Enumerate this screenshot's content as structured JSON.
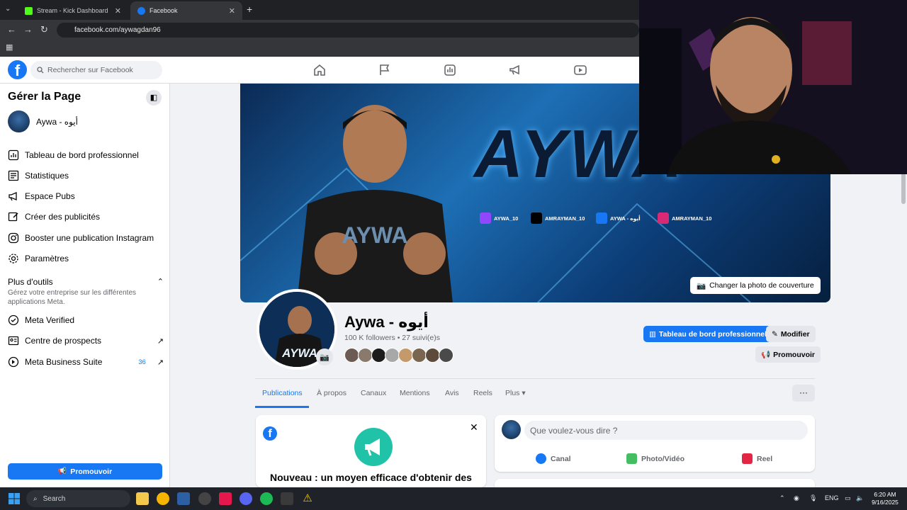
{
  "browser": {
    "tabs": [
      {
        "title": "Stream - Kick Dashboard",
        "active": false,
        "color": "#53fc18"
      },
      {
        "title": "Facebook",
        "active": true,
        "color": "#1877f2"
      }
    ],
    "new_tab": "+",
    "url": "facebook.com/aywagdan96"
  },
  "header": {
    "logo": "f",
    "search_placeholder": "Rechercher sur Facebook",
    "nav_icons": [
      "home-icon",
      "flag-icon",
      "dashboard-icon",
      "megaphone-icon",
      "video-icon"
    ]
  },
  "sidebar": {
    "title": "Gérer la Page",
    "page_name": "Aywa - أيوه",
    "items": [
      {
        "label": "Tableau de bord professionnel",
        "icon": "dashboard-icon"
      },
      {
        "label": "Statistiques",
        "icon": "stats-icon"
      },
      {
        "label": "Espace Pubs",
        "icon": "megaphone-icon"
      },
      {
        "label": "Créer des publicités",
        "icon": "edit-icon"
      },
      {
        "label": "Booster une publication Instagram",
        "icon": "instagram-icon"
      },
      {
        "label": "Paramètres",
        "icon": "gear-icon"
      }
    ],
    "more_tools": {
      "title": "Plus d'outils",
      "description": "Gérez votre entreprise sur les différentes applications Meta."
    },
    "tools": [
      {
        "label": "Meta Verified",
        "icon": "verified-icon",
        "badge": ""
      },
      {
        "label": "Centre de prospects",
        "icon": "prospects-icon",
        "badge": ""
      },
      {
        "label": "Meta Business Suite",
        "icon": "business-icon",
        "badge": "36"
      }
    ],
    "promote_button": "Promouvoir"
  },
  "cover": {
    "title": "AYWA",
    "socials": [
      {
        "name": "AYWA_10",
        "color": "#9146ff"
      },
      {
        "name": "AMRAYMAN_10",
        "color": "#000000"
      },
      {
        "name": "AYWA - أيوه",
        "color": "#1877f2"
      },
      {
        "name": "AMRAYMAN_10",
        "color": "#d62976"
      }
    ],
    "change_cover": "Changer la photo de couverture"
  },
  "profile": {
    "name": "Aywa - أيوه",
    "stats": "100 K followers • 27 suivi(e)s",
    "friend_colors": [
      "#6b5b52",
      "#8a7a6e",
      "#1c1c1c",
      "#a8a8a8",
      "#c49a6c",
      "#7a6650",
      "#5c4a3a",
      "#4a4a4a"
    ],
    "dashboard_button": "Tableau de bord professionnel",
    "edit_button": "Modifier",
    "promote_button": "Promouvoir"
  },
  "page_tabs": {
    "items": [
      "Publications",
      "À propos",
      "Canaux",
      "Mentions",
      "Avis",
      "Reels",
      "Plus"
    ],
    "active": "Publications",
    "more_menu": "···"
  },
  "notice_card": {
    "title_line1": "Nouveau : un moyen efficace d'obtenir des",
    "close": "✕"
  },
  "composer": {
    "placeholder": "Que voulez-vous dire ?",
    "actions": [
      {
        "label": "Canal",
        "color": "#1877f2"
      },
      {
        "label": "Photo/Vidéo",
        "color": "#45bd62"
      },
      {
        "label": "Reel",
        "color": "#e42645"
      }
    ]
  },
  "taskbar": {
    "search_label": "Search",
    "language": "ENG",
    "time": "6:20 AM",
    "date": "9/16/2025"
  }
}
